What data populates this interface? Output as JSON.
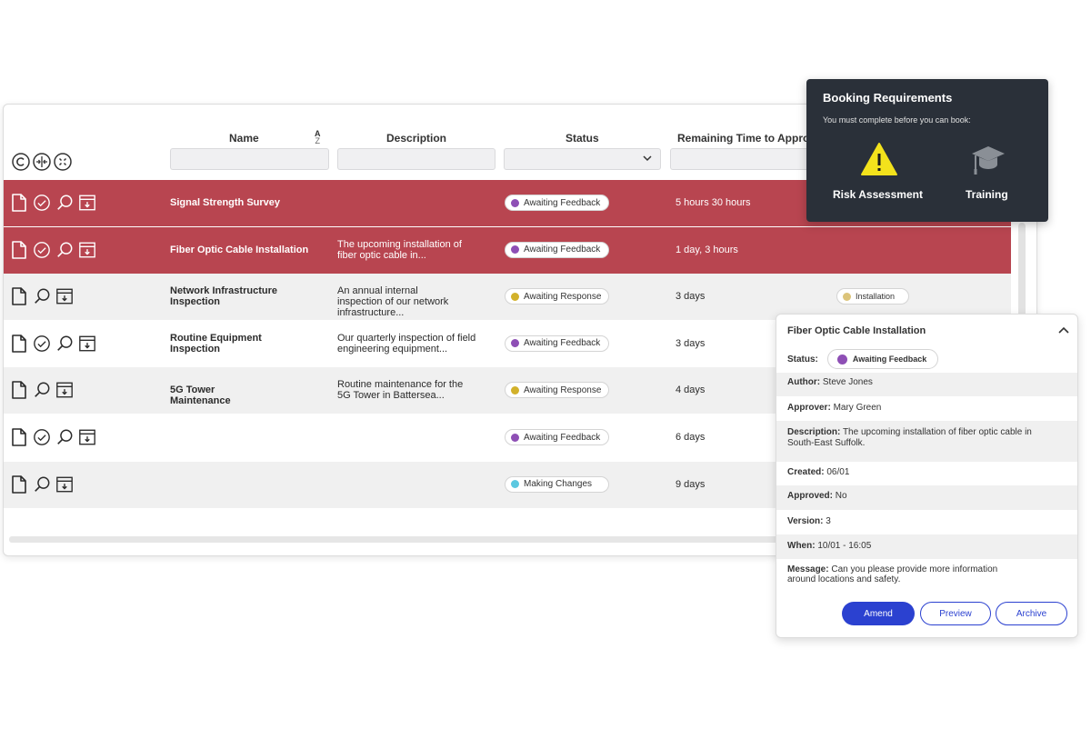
{
  "table": {
    "columns": {
      "name": "Name",
      "description": "Description",
      "status": "Status",
      "remaining": "Remaining Time to Approv",
      "sort_a": "A",
      "sort_z": "Z"
    },
    "rows": [
      {
        "name": "Signal Strength Survey",
        "description": "",
        "status": "Awaiting Feedback",
        "status_color": "#8e4fb5",
        "remaining": "5 hours 30 hours",
        "icons": [
          "document-icon",
          "check-circle-icon",
          "search-icon",
          "archive-icon"
        ]
      },
      {
        "name": "Fiber Optic Cable Installation",
        "description": "The upcoming installation of fiber optic cable in...",
        "status": "Awaiting Feedback",
        "status_color": "#8e4fb5",
        "remaining": "1 day, 3 hours",
        "icons": [
          "document-icon",
          "check-circle-icon",
          "search-icon",
          "archive-icon"
        ]
      },
      {
        "name": "Network Infrastructure Inspection",
        "description": "An annual internal inspection of our network infrastructure...",
        "status": "Awaiting Response",
        "status_color": "#d2b12a",
        "remaining": "3 days",
        "tag": "Installation",
        "tag_color": "#dcc47a",
        "icons": [
          "document-icon",
          "search-icon",
          "archive-icon"
        ]
      },
      {
        "name": "Routine Equipment Inspection",
        "description": "Our quarterly inspection of field engineering equipment...",
        "status": "Awaiting Feedback",
        "status_color": "#8e4fb5",
        "remaining": "3 days",
        "icons": [
          "document-icon",
          "check-circle-icon",
          "search-icon",
          "archive-icon"
        ]
      },
      {
        "name": "5G Tower Maintenance",
        "description": "Routine maintenance for the 5G Tower in Battersea...",
        "status": "Awaiting Response",
        "status_color": "#d2b12a",
        "remaining": "4 days",
        "icons": [
          "document-icon",
          "search-icon",
          "archive-icon"
        ]
      },
      {
        "name": "",
        "description": "",
        "status": "Awaiting Feedback",
        "status_color": "#8e4fb5",
        "remaining": "6 days",
        "icons": [
          "document-icon",
          "check-circle-icon",
          "search-icon",
          "archive-icon"
        ]
      },
      {
        "name": "",
        "description": "",
        "status": "Making Changes",
        "status_color": "#5bc8e0",
        "remaining": "9 days",
        "icons": [
          "document-icon",
          "search-icon",
          "archive-icon"
        ]
      }
    ]
  },
  "booking": {
    "title": "Booking Requirements",
    "subtitle": "You must complete before you can book:",
    "item1": "Risk Assessment",
    "item2": "Training"
  },
  "detail": {
    "title": "Fiber Optic Cable Installation",
    "status_label": "Status:",
    "status_value": "Awaiting Feedback",
    "author_label": "Author:",
    "author": "Steve Jones",
    "approver_label": "Approver:",
    "approver": "Mary Green",
    "description_label": "Description:",
    "description": "The upcoming installation of fiber optic cable in South-East Suffolk.",
    "created_label": "Created:",
    "created": "06/01",
    "approved_label": "Approved:",
    "approved": "No",
    "version_label": "Version:",
    "version": "3",
    "when_label": "When:",
    "when": "10/01 - 16:05",
    "message_label": "Message:",
    "message": "Can you please provide more information around locations and safety.",
    "amend": "Amend",
    "preview": "Preview",
    "archive": "Archive"
  },
  "colors": {
    "selected_row": "#b84550",
    "accent": "#2b41d0",
    "tooltip_bg": "#2a3039",
    "warning": "#f3e21c"
  }
}
